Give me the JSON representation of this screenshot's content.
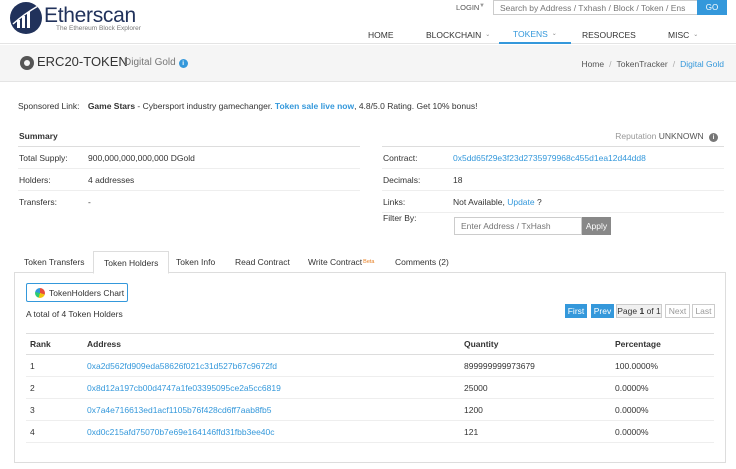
{
  "header": {
    "brand": "Etherscan",
    "tagline": "The Ethereum Block Explorer",
    "login_label": "LOGIN",
    "search_placeholder": "Search by Address / Txhash / Block / Token / Ens",
    "go_label": "GO",
    "nav": [
      {
        "label": "HOME",
        "dropdown": false
      },
      {
        "label": "BLOCKCHAIN",
        "dropdown": true
      },
      {
        "label": "TOKENS",
        "dropdown": true,
        "active": true
      },
      {
        "label": "RESOURCES",
        "dropdown": false
      },
      {
        "label": "MISC",
        "dropdown": true
      }
    ]
  },
  "titlebar": {
    "title": "ERC20-TOKEN",
    "subtitle": "Digital Gold",
    "breadcrumbs": [
      "Home",
      "TokenTracker",
      "Digital Gold"
    ]
  },
  "sponsored": {
    "label": "Sponsored Link:",
    "name": "Game Stars",
    "text": " - Cybersport industry gamechanger. ",
    "link": "Token sale live now",
    "tail": ", 4.8/5.0 Rating. Get 10% bonus!"
  },
  "summary": {
    "heading": "Summary",
    "reputation_label": "Reputation",
    "reputation_value": "UNKNOWN",
    "left": [
      {
        "key": "Total Supply:",
        "value": "900,000,000,000,000 DGold"
      },
      {
        "key": "Holders:",
        "value": "4 addresses"
      },
      {
        "key": "Transfers:",
        "value": "-"
      }
    ],
    "contract_key": "Contract:",
    "contract_value": "0x5dd65f29e3f23d2735979968c455d1ea12d44dd8",
    "decimals_key": "Decimals:",
    "decimals_value": "18",
    "links_key": "Links:",
    "links_value": "Not Available,",
    "links_update": "Update",
    "links_q": "?",
    "filter_key": "Filter By:",
    "filter_placeholder": "Enter Address / TxHash",
    "apply_label": "Apply"
  },
  "tabs": [
    {
      "label": "Token Transfers"
    },
    {
      "label": "Token Holders",
      "active": true
    },
    {
      "label": "Token Info"
    },
    {
      "label": "Read Contract"
    },
    {
      "label": "Write Contract",
      "badge": "Beta"
    },
    {
      "label": "Comments (2)"
    }
  ],
  "holders": {
    "chart_button": "TokenHolders Chart",
    "total_text": "A total of 4 Token Holders",
    "pager": {
      "first": "First",
      "prev": "Prev",
      "page_prefix": "Page",
      "current": "1",
      "of": "of",
      "total": "1",
      "next": "Next",
      "last": "Last"
    },
    "columns": [
      "Rank",
      "Address",
      "Quantity",
      "Percentage"
    ],
    "rows": [
      {
        "rank": "1",
        "address": "0xa2d562fd909eda58626f021c31d527b67c9672fd",
        "quantity": "899999999973679",
        "percentage": "100.0000%"
      },
      {
        "rank": "2",
        "address": "0x8d12a197cb00d4747a1fe03395095ce2a5cc6819",
        "quantity": "25000",
        "percentage": "0.0000%"
      },
      {
        "rank": "3",
        "address": "0x7a4e716613ed1acf1105b76f428cd6ff7aab8fb5",
        "quantity": "1200",
        "percentage": "0.0000%"
      },
      {
        "rank": "4",
        "address": "0xd0c215afd75070b7e69e164146ffd31fbb3ee40c",
        "quantity": "121",
        "percentage": "0.0000%"
      }
    ]
  },
  "colors": {
    "accent": "#3498db",
    "brand": "#21325b"
  }
}
